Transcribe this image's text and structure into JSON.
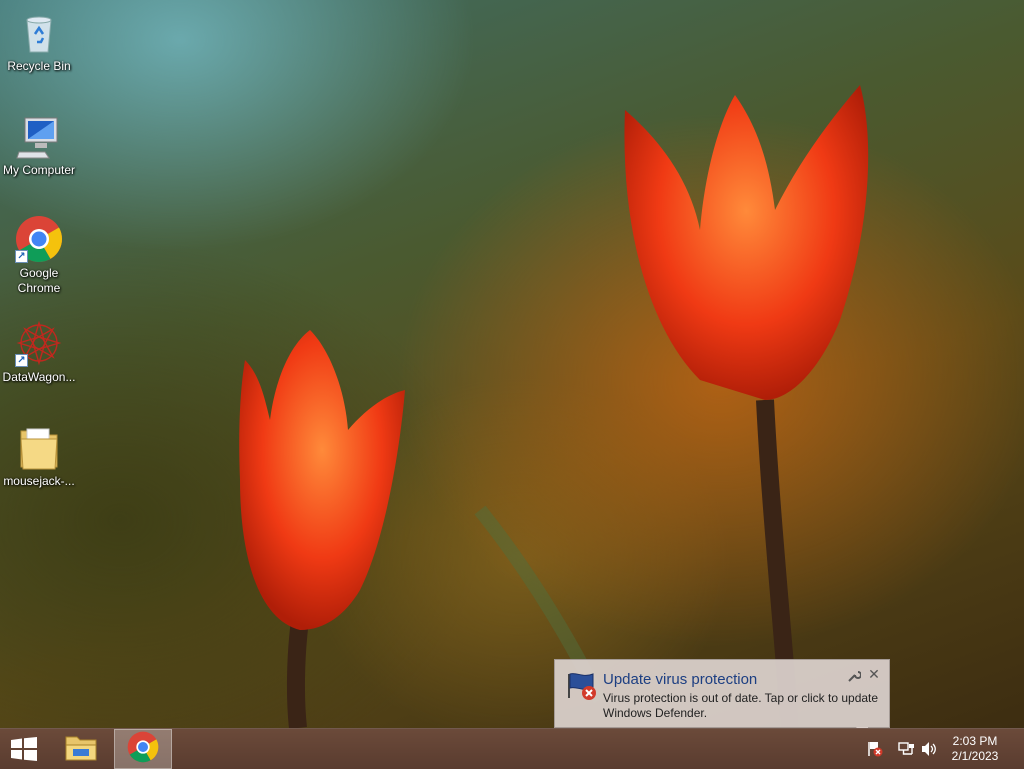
{
  "desktop": {
    "icons": [
      {
        "label": "Recycle Bin",
        "icon": "recycle-bin-icon"
      },
      {
        "label": "My Computer",
        "icon": "computer-icon"
      },
      {
        "label": "Google Chrome",
        "icon": "chrome-icon"
      },
      {
        "label": "DataWagon...",
        "icon": "datawagon-icon"
      },
      {
        "label": "mousejack-...",
        "icon": "folder-icon"
      }
    ]
  },
  "notification": {
    "title": "Update virus protection",
    "body": "Virus protection is out of date. Tap or click to update Windows Defender.",
    "icon": "defender-flag-error-icon"
  },
  "taskbar": {
    "pinned": [
      {
        "name": "file-explorer",
        "icon": "folder-icon"
      },
      {
        "name": "google-chrome",
        "icon": "chrome-icon",
        "active": true
      }
    ],
    "tray": [
      "action-center-error-icon",
      "network-icon",
      "volume-icon"
    ],
    "clock": {
      "time": "2:03 PM",
      "date": "2/1/2023"
    }
  },
  "colors": {
    "taskbar": "#5f4233",
    "notification_title": "#1d3f82",
    "chrome_red": "#db4437",
    "chrome_yellow": "#f4c20d",
    "chrome_green": "#0f9d58",
    "chrome_blue": "#4285f4"
  }
}
